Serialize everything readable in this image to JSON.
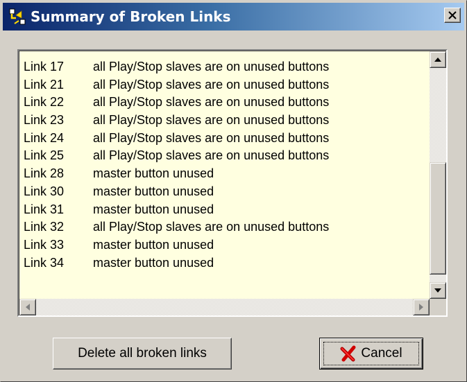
{
  "window": {
    "title": "Summary of Broken Links",
    "app_icon": "network-links-icon",
    "close_icon": "close-icon"
  },
  "list": {
    "rows": [
      {
        "id": "Link 17",
        "reason": "all Play/Stop slaves are on unused buttons"
      },
      {
        "id": "Link 21",
        "reason": "all Play/Stop slaves are on unused buttons"
      },
      {
        "id": "Link 22",
        "reason": "all Play/Stop slaves are on unused buttons"
      },
      {
        "id": "Link 23",
        "reason": "all Play/Stop slaves are on unused buttons"
      },
      {
        "id": "Link 24",
        "reason": "all Play/Stop slaves are on unused buttons"
      },
      {
        "id": "Link 25",
        "reason": "all Play/Stop slaves are on unused buttons"
      },
      {
        "id": "Link 28",
        "reason": "master button unused"
      },
      {
        "id": "Link 30",
        "reason": "master button unused"
      },
      {
        "id": "Link 31",
        "reason": "master button unused"
      },
      {
        "id": "Link 32",
        "reason": "all Play/Stop slaves are on unused buttons"
      },
      {
        "id": "Link 33",
        "reason": "master button unused"
      },
      {
        "id": "Link 34",
        "reason": "master button unused"
      }
    ]
  },
  "buttons": {
    "delete_label": "Delete all broken links",
    "cancel_label": "Cancel",
    "cancel_icon": "red-x-icon"
  }
}
